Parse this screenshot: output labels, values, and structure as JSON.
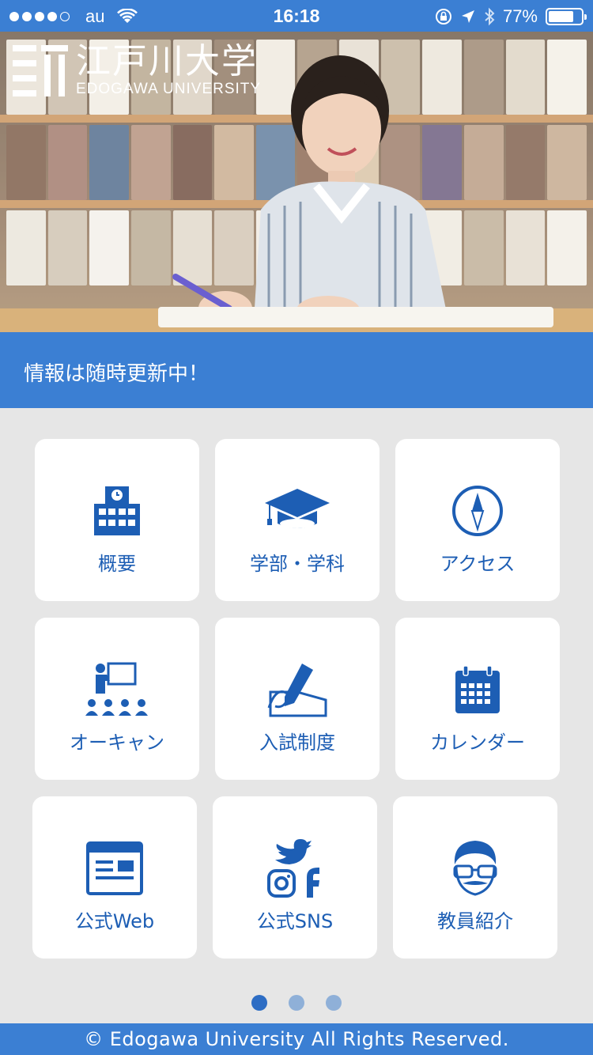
{
  "status_bar": {
    "carrier": "au",
    "time": "16:18",
    "battery_percent": "77%",
    "battery_level": 0.77,
    "signal_dots_filled": 4,
    "signal_dots_total": 5
  },
  "hero": {
    "logo_jp": "江戸川大学",
    "logo_en": "EDOGAWA UNIVERSITY"
  },
  "banner": {
    "text": "情報は随時更新中！"
  },
  "menu": {
    "items": [
      {
        "label": "概要",
        "icon": "school-building-icon"
      },
      {
        "label": "学部・学科",
        "icon": "graduation-cap-icon"
      },
      {
        "label": "アクセス",
        "icon": "compass-icon"
      },
      {
        "label": "オーキャン",
        "icon": "presentation-audience-icon"
      },
      {
        "label": "入試制度",
        "icon": "pen-writing-icon"
      },
      {
        "label": "カレンダー",
        "icon": "calendar-icon"
      },
      {
        "label": "公式Web",
        "icon": "browser-window-icon"
      },
      {
        "label": "公式SNS",
        "icon": "social-media-icon"
      },
      {
        "label": "教員紹介",
        "icon": "teacher-face-icon"
      }
    ]
  },
  "pager": {
    "pages": 3,
    "active": 1
  },
  "footer": {
    "text": "© Edogawa University All Rights Reserved."
  },
  "colors": {
    "primary": "#3b7fd3",
    "icon": "#1d5eb4",
    "background": "#e6e6e6"
  }
}
